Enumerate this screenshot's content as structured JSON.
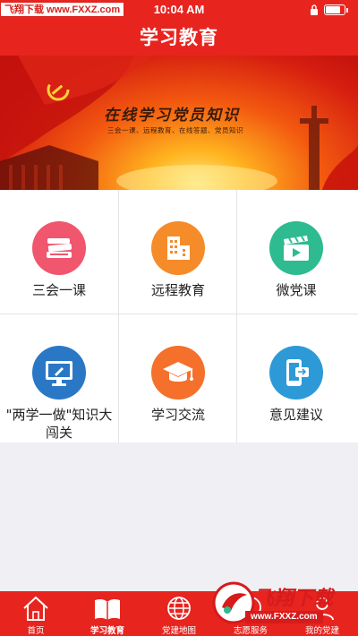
{
  "status_bar": {
    "watermark": "飞翔下载 www.FXXZ.com",
    "time": "10:04 AM",
    "battery_level": 0.8
  },
  "header": {
    "title": "学习教育"
  },
  "banner": {
    "title": "在线学习党员知识",
    "subtitle": "三会一课、远程教育、在线答题、党员知识"
  },
  "menu": [
    {
      "label": "三会一课",
      "icon": "books-icon",
      "color": "#f0566e"
    },
    {
      "label": "远程教育",
      "icon": "building-icon",
      "color": "#f68b29"
    },
    {
      "label": "微党课",
      "icon": "clapperboard-icon",
      "color": "#2dbb8f"
    },
    {
      "label": "\"两学一做\"知识大闯关",
      "icon": "monitor-edit-icon",
      "color": "#2a78c5"
    },
    {
      "label": "学习交流",
      "icon": "graduation-cap-icon",
      "color": "#f4702b"
    },
    {
      "label": "意见建议",
      "icon": "phone-transfer-icon",
      "color": "#2d9ad7"
    }
  ],
  "tabs": [
    {
      "label": "首页",
      "icon": "home-icon"
    },
    {
      "label": "学习教育",
      "icon": "book-icon",
      "active": true
    },
    {
      "label": "党建地图",
      "icon": "globe-icon"
    },
    {
      "label": "志愿服务",
      "icon": "service-icon"
    },
    {
      "label": "我的党建",
      "icon": "person-icon"
    }
  ],
  "watermark_badge": {
    "brand": "飞翔下载",
    "url": "www.FXXZ.com"
  }
}
